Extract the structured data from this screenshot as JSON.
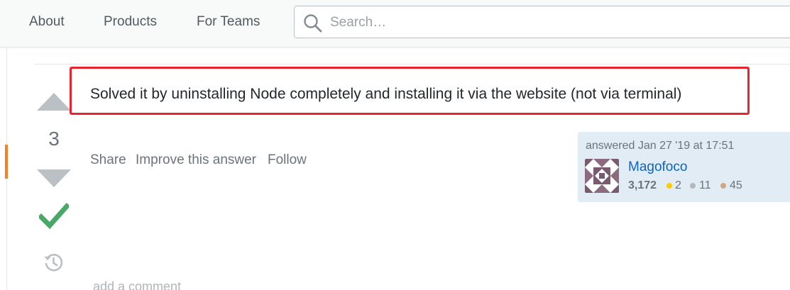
{
  "nav": {
    "about": "About",
    "products": "Products",
    "for_teams": "For Teams"
  },
  "search": {
    "placeholder": "Search…",
    "icon": "search-icon"
  },
  "vote": {
    "count": "3",
    "accepted": true
  },
  "answer": {
    "text": "Solved it by uninstalling Node completely and installing it via the website (not via terminal)",
    "highlight_color": "#e8242c"
  },
  "post_menu": {
    "share": "Share",
    "improve": "Improve this answer",
    "follow": "Follow"
  },
  "user_card": {
    "action_time": "answered Jan 27 '19 at 17:51",
    "name": "Magofoco",
    "reputation": "3,172",
    "badges": {
      "gold": "2",
      "silver": "11",
      "bronze": "45"
    }
  },
  "comments": {
    "add_label": "add a comment"
  },
  "colors": {
    "accent_orange": "#f48225",
    "link_blue": "#0c65c3",
    "accepted_green": "#48a868",
    "card_bg": "#e1ecf4",
    "gold": "#ffcc01",
    "silver": "#b4b8bc",
    "bronze": "#d1a684"
  }
}
